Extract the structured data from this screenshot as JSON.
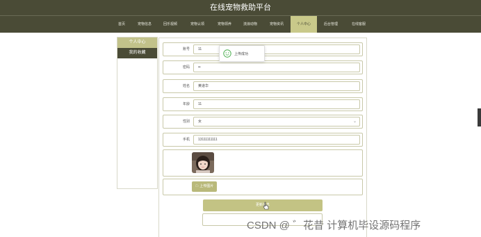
{
  "header": {
    "title": "在线宠物救助平台"
  },
  "nav": {
    "items": [
      {
        "label": "首页"
      },
      {
        "label": "宠物信息"
      },
      {
        "label": "回乐视频"
      },
      {
        "label": "宠物认领"
      },
      {
        "label": "宠物领养"
      },
      {
        "label": "流浪动物"
      },
      {
        "label": "宠物资讯"
      },
      {
        "label": "个人中心"
      },
      {
        "label": "后台管理"
      },
      {
        "label": "在线客服"
      }
    ],
    "active_index": 7
  },
  "sidebar": {
    "items": [
      {
        "label": "个人中心"
      },
      {
        "label": "我的收藏"
      }
    ]
  },
  "form": {
    "account": {
      "label": "账号",
      "value": "11"
    },
    "password": {
      "label": "密码",
      "value": "••"
    },
    "name": {
      "label": "姓名",
      "value": "黄道华"
    },
    "age": {
      "label": "年龄",
      "value": "11"
    },
    "gender": {
      "label": "性别",
      "value": "女"
    },
    "phone": {
      "label": "手机",
      "value": "13111111111"
    }
  },
  "toast": {
    "text": "上传成功"
  },
  "upload": {
    "label": "上传图片"
  },
  "save": {
    "label": "更新信息"
  },
  "watermark": {
    "text": "CSDN @ ゛花昔  计算机毕设源码程序"
  },
  "colors": {
    "header_bg": "#4a4b36",
    "accent": "#c3c384",
    "toast_icon": "#4caf50"
  }
}
